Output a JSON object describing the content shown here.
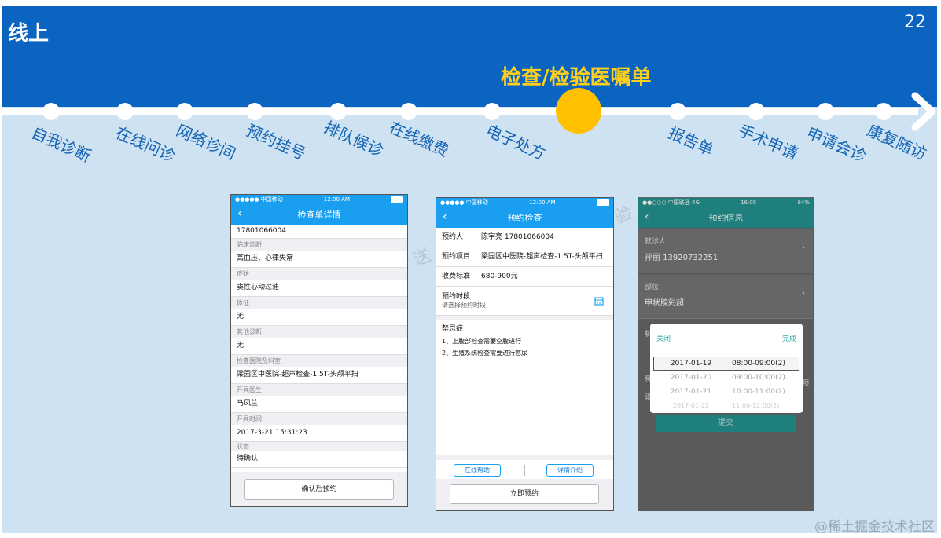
{
  "header": {
    "section_title": "线上",
    "page_number": "22",
    "highlight_title": "检查/检验医嘱单"
  },
  "timeline": {
    "steps": [
      "自我诊断",
      "在线问诊",
      "网络诊间",
      "预约挂号",
      "排队候诊",
      "在线缴费",
      "电子处方",
      "报告单",
      "手术申请",
      "申请会诊",
      "康复随访"
    ],
    "accent_color": "#ffc000",
    "band_color": "#0a64c0"
  },
  "ghost_text": {
    "left": "送",
    "right": "验"
  },
  "phone1": {
    "status": {
      "carrier": "●●●●● 中国移动",
      "time": "12:00 AM"
    },
    "title": "检查单详情",
    "phone_number": "17801066004",
    "fields": [
      {
        "label": "临床诊断",
        "value": "高血压、心律失常"
      },
      {
        "label": "症状",
        "value": "窦性心动过速"
      },
      {
        "label": "体征",
        "value": "无"
      },
      {
        "label": "其他诊断",
        "value": "无"
      },
      {
        "label": "检查医院及科室",
        "value": "梁园区中医院-超声检查-1.5T-头颅平扫"
      },
      {
        "label": "开具医生",
        "value": "马凤兰"
      },
      {
        "label": "开具时间",
        "value": "2017-3-21  15:31:23"
      },
      {
        "label": "状态",
        "value": "待确认"
      }
    ],
    "button": "确认后预约"
  },
  "phone2": {
    "status": {
      "carrier": "●●●●● 中国移动",
      "time": "12:00 AM"
    },
    "title": "预约检查",
    "person_label": "预约人",
    "person_value": "陈宇亮  17801066004",
    "item_label": "预约项目",
    "item_value": "梁园区中医院-超声检查-1.5T-头颅平扫",
    "fee_label": "收费标准",
    "fee_value": "680-900元",
    "time_label": "预约时段",
    "time_placeholder": "请选择预约时段",
    "contra_title": "禁忌症",
    "contra_1": "1、上腹部检查需要空腹进行",
    "contra_2": "2、生殖系统检查需要进行憋尿",
    "help_button": "在线帮助",
    "detail_button": "详情介绍",
    "book_button": "立即预约"
  },
  "phone3": {
    "status": {
      "carrier": "●●○○○ 中国联通  4G",
      "time": "16:05",
      "battery": "64%"
    },
    "title": "预约信息",
    "patient_label": "就诊人",
    "patient_value": "孙丽  13920732251",
    "part_label": "部位",
    "part_value": "甲状腺彩超",
    "cut_label_1": "机",
    "cut_label_2": "预",
    "cut_label_3": "请",
    "cut_label_4": "预",
    "picker": {
      "close": "关闭",
      "done": "完成",
      "rows": [
        {
          "date": "2017-01-19",
          "time": "08:00-09:00(2)"
        },
        {
          "date": "2017-01-20",
          "time": "09:00-10:00(2)"
        },
        {
          "date": "2017-01-21",
          "time": "10:00-11:00(2)"
        },
        {
          "date": "2017-01-22",
          "time": "11:00-12:00(2)"
        }
      ]
    },
    "submit": "提交"
  },
  "watermark": "@稀土掘金技术社区"
}
